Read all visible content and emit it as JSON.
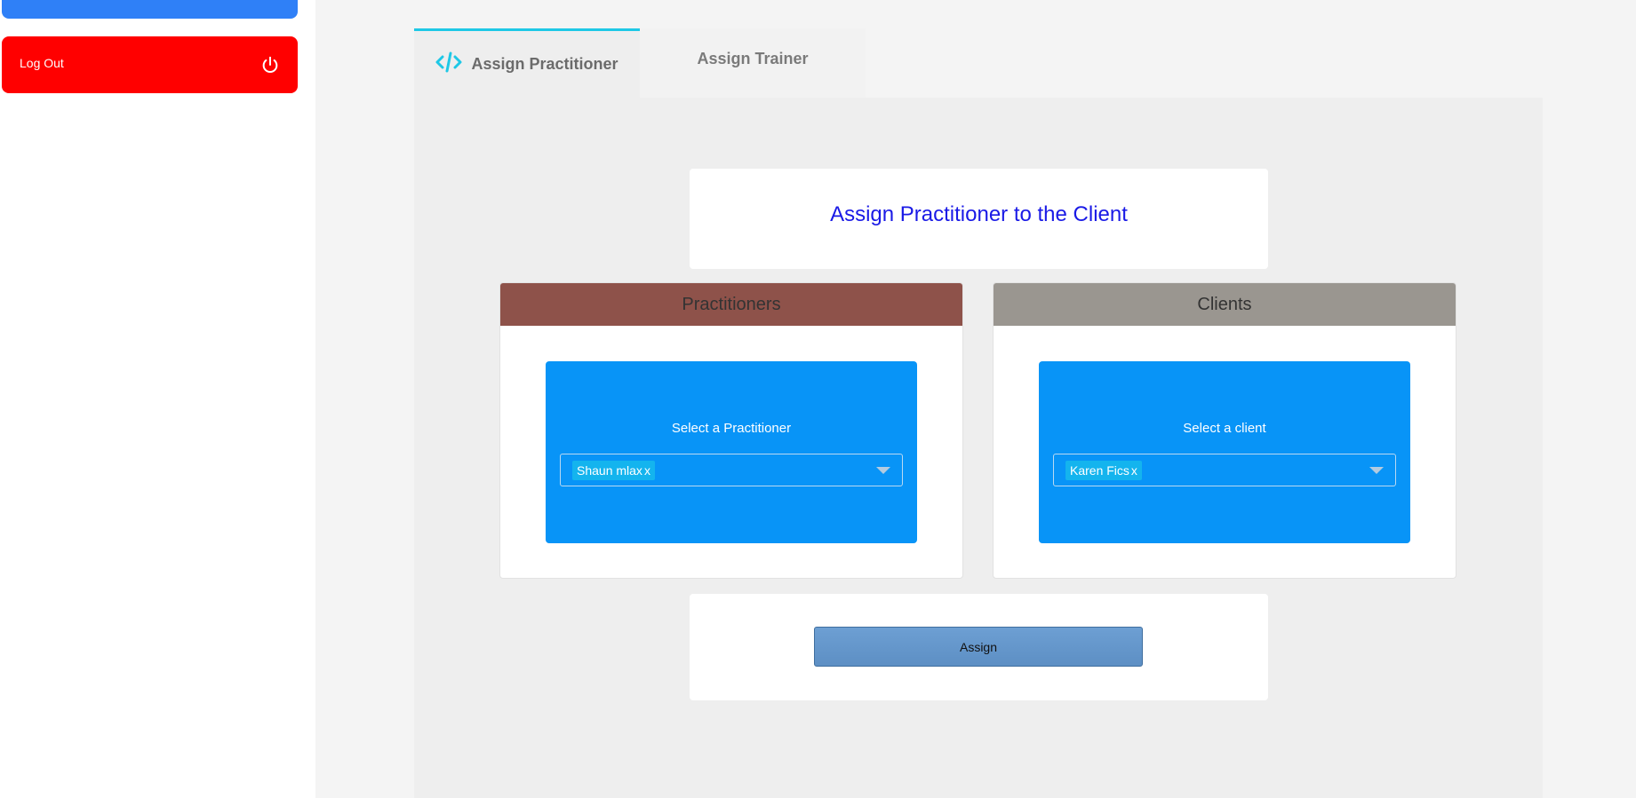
{
  "sidebar": {
    "logout_label": "Log Out"
  },
  "tabs": [
    {
      "label": "Assign Practitioner",
      "active": true
    },
    {
      "label": "Assign Trainer",
      "active": false
    }
  ],
  "main": {
    "title": "Assign Practitioner to the Client",
    "practitioners": {
      "header": "Practitioners",
      "select_label": "Select a Practitioner",
      "selected_value": "Shaun mlax",
      "remove_glyph": "x"
    },
    "clients": {
      "header": "Clients",
      "select_label": "Select a client",
      "selected_value": "Karen Fics",
      "remove_glyph": "x"
    },
    "assign_label": "Assign"
  },
  "colors": {
    "logout_bg": "#ff0000",
    "accent_blue": "#2f80f7",
    "tab_accent": "#1ec8e6",
    "title_color": "#1a1ae6",
    "practitioners_header": "#8e524a",
    "clients_header": "#9a9690",
    "select_bg": "#0894f7"
  },
  "icons": {
    "logout": "power-icon",
    "tab": "code-icon",
    "dropdown": "chevron-down-icon"
  }
}
